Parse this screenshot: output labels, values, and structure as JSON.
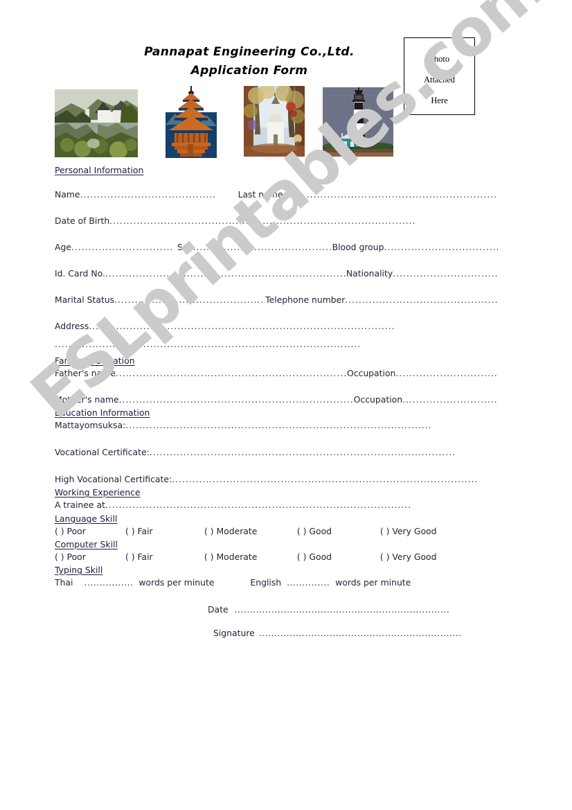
{
  "header": {
    "company_title": "Pannapat Engineering Co.,Ltd.",
    "form_title": "Application Form",
    "photo_box": {
      "line1": "Photo",
      "line2": "Attached",
      "line3": "Here"
    }
  },
  "images": [
    {
      "name": "house-by-lake-painting",
      "alt": "White house beside a lake with green trees"
    },
    {
      "name": "pagoda-temple-clipart",
      "alt": "Multi-tiered orange-roofed pagoda temple"
    },
    {
      "name": "autumn-church-painting",
      "alt": "White church among autumn trees"
    },
    {
      "name": "lighthouse-illustration",
      "alt": "Black and white striped lighthouse"
    }
  ],
  "sections": {
    "personal": {
      "heading": "Personal Information",
      "name_label": "Name",
      "last_name_label": "Last name",
      "dob_label": "Date of Birth",
      "age_label": "Age",
      "sex_label": "Sex",
      "blood_group_label": "Blood group",
      "id_card_label": "Id. Card No.",
      "nationality_label": "Nationality",
      "marital_label": "Marital Status",
      "telephone_label": "Telephone number",
      "address_label": "Address"
    },
    "family": {
      "heading": "Family Information",
      "father_label": "Father's name",
      "father_occupation_label": "Occupation",
      "mother_label": "Mother's name",
      "mother_occupation_label": "Occupation"
    },
    "education": {
      "heading": "Education Information",
      "mattayom_label": "Mattayomsuksa:",
      "vocational_label": "Vocational Certificate:",
      "high_vocational_label": "High Vocational Certificate:"
    },
    "working": {
      "heading": "Working Experience",
      "trainee_label": "A trainee at"
    },
    "language_skill": {
      "heading": "Language Skill",
      "options": [
        "( ) Poor",
        "( ) Fair",
        "( ) Moderate",
        "( ) Good",
        "( ) Very Good"
      ]
    },
    "computer_skill": {
      "heading": "Computer Skill",
      "options": [
        "( ) Poor",
        "( ) Fair",
        "( ) Moderate",
        "( ) Good",
        "( ) Very Good"
      ]
    },
    "typing_skill": {
      "heading": "Typing Skill",
      "thai_label": "Thai",
      "thai_unit": "words per minute",
      "english_label": "English",
      "english_unit": "words per minute"
    }
  },
  "footer": {
    "date_label": "Date",
    "signature_label": "Signature"
  },
  "watermark": {
    "text": "ESLprintables.com",
    "color": "#cbcbcb"
  },
  "dots": {
    "d6": "......",
    "d10": "..........",
    "d14": "..............",
    "d16": "................",
    "d20": "....................",
    "d22": "......................",
    "d26": "..........................",
    "d30": "..............................",
    "d36": "....................................",
    "d40": "........................................",
    "d44": "............................................",
    "d50": "..................................................",
    "d56": "........................................................",
    "d60": "............................................................",
    "d66": "..................................................................",
    "d70": "......................................................................",
    "d76": "............................................................................",
    "d80": "................................................................................",
    "d90": ".........................................................................................."
  }
}
